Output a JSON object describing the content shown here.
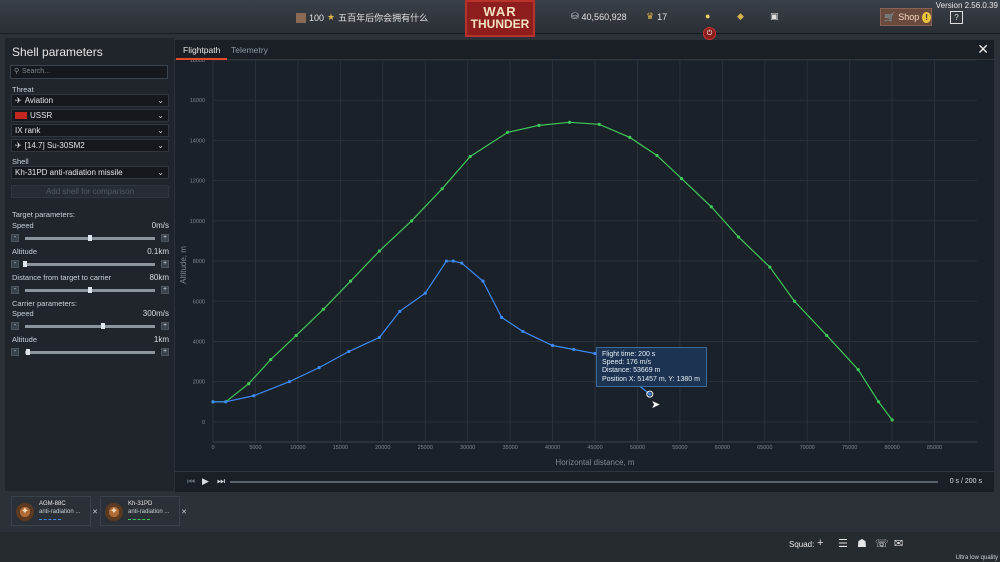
{
  "topbar": {
    "version": "Version 2.56.0.39",
    "rank_number": "100",
    "title": "五百年后你会拥有什么",
    "logo_line1": "WAR",
    "logo_line2": "THUNDER",
    "silver_lions": "40,560,928",
    "eagles": "17",
    "shop_label": "Shop",
    "shop_alert": "!",
    "help": "?"
  },
  "sidebar": {
    "title": "Shell parameters",
    "search_placeholder": "Search...",
    "threat_label": "Threat",
    "threat_options": {
      "threat": "Aviation",
      "country": "USSR",
      "rank": "IX rank",
      "vehicle": "[14.7] Su-30SM2"
    },
    "shell_label": "Shell",
    "shell_value": "Kh-31PD anti-radiation missile",
    "add_shell": "Add shell for comparison",
    "target_params_label": "Target parameters:",
    "carrier_params_label": "Carrier parameters:",
    "sliders": {
      "target_speed": {
        "label": "Speed",
        "value": "0m/s",
        "level": 0.5
      },
      "target_altitude": {
        "label": "Altitude",
        "value": "0.1km",
        "level": 0.0
      },
      "distance": {
        "label": "Distance from target to carrier",
        "value": "80km",
        "level": 0.5
      },
      "carrier_speed": {
        "label": "Speed",
        "value": "300m/s",
        "level": 0.6
      },
      "carrier_altitude": {
        "label": "Altitude",
        "value": "1km",
        "level": 0.02
      }
    }
  },
  "main": {
    "tabs": [
      "Flightpath",
      "Telemetry"
    ],
    "active_tab": "Flightpath",
    "close": "✕"
  },
  "tooltip": {
    "line1": "Flight time: 200 s",
    "line2": "Speed: 176 m/s",
    "line3": "Distance: 53669 m",
    "line4": "Position X: 51457 m, Y: 1380 m"
  },
  "player": {
    "time": "0 s  /  200 s"
  },
  "comparison_cards": [
    {
      "name": "AGM-88C",
      "type": "anti-radiation ...",
      "color": "#3d8bff"
    },
    {
      "name": "Kh-31PD",
      "type": "anti-radiation ...",
      "color": "#3fc95a"
    }
  ],
  "bottombar": {
    "squad_label": "Squad:",
    "quality": "Ultra low quality"
  },
  "chart_data": {
    "type": "line",
    "xlabel": "Horizontal distance, m",
    "ylabel": "Altitude, m",
    "xlim": [
      0,
      90000
    ],
    "ylim": [
      -1000,
      18000
    ],
    "xticks": [
      0,
      5000,
      10000,
      15000,
      20000,
      25000,
      30000,
      35000,
      40000,
      45000,
      50000,
      55000,
      60000,
      65000,
      70000,
      75000,
      80000,
      85000
    ],
    "xtick_labels": [
      "0",
      "5000",
      "10000",
      "15000",
      "20000",
      "25000",
      "30000",
      "35000",
      "40000",
      "45000",
      "50000",
      "55000",
      "60000",
      "65000",
      "70000",
      "75000",
      "80000",
      "85000"
    ],
    "yticks": [
      0,
      2000,
      4000,
      6000,
      8000,
      10000,
      12000,
      14000,
      16000,
      18000
    ],
    "ytick_labels": [
      "0",
      "2000",
      "4000",
      "6000",
      "8000",
      "10000",
      "12000",
      "14000",
      "16000",
      "18000"
    ],
    "grid": true,
    "series": [
      {
        "color": "#3fc95a",
        "x": [
          0,
          1500,
          4200,
          6800,
          9800,
          13000,
          16200,
          19600,
          23400,
          27000,
          30300,
          34700,
          38400,
          42000,
          45500,
          49100,
          52300,
          55200,
          58700,
          61900,
          65600,
          68500,
          72300,
          76000,
          78400,
          80000
        ],
        "y": [
          1000,
          1000,
          1900,
          3100,
          4300,
          5600,
          7000,
          8500,
          10000,
          11600,
          13200,
          14400,
          14750,
          14900,
          14800,
          14150,
          13250,
          12100,
          10700,
          9200,
          7700,
          6000,
          4300,
          2600,
          1000,
          100
        ]
      },
      {
        "color": "#3d8bff",
        "x": [
          0,
          1500,
          4800,
          9000,
          12500,
          16000,
          19600,
          22000,
          25000,
          27500,
          28300,
          29300,
          31800,
          34000,
          36500,
          40000,
          42500,
          45000,
          47000,
          49000,
          51457
        ],
        "y": [
          1000,
          1000,
          1300,
          2000,
          2700,
          3500,
          4200,
          5500,
          6400,
          8000,
          8000,
          7900,
          7000,
          5200,
          4500,
          3800,
          3600,
          3400,
          3100,
          2200,
          1380
        ]
      }
    ]
  }
}
